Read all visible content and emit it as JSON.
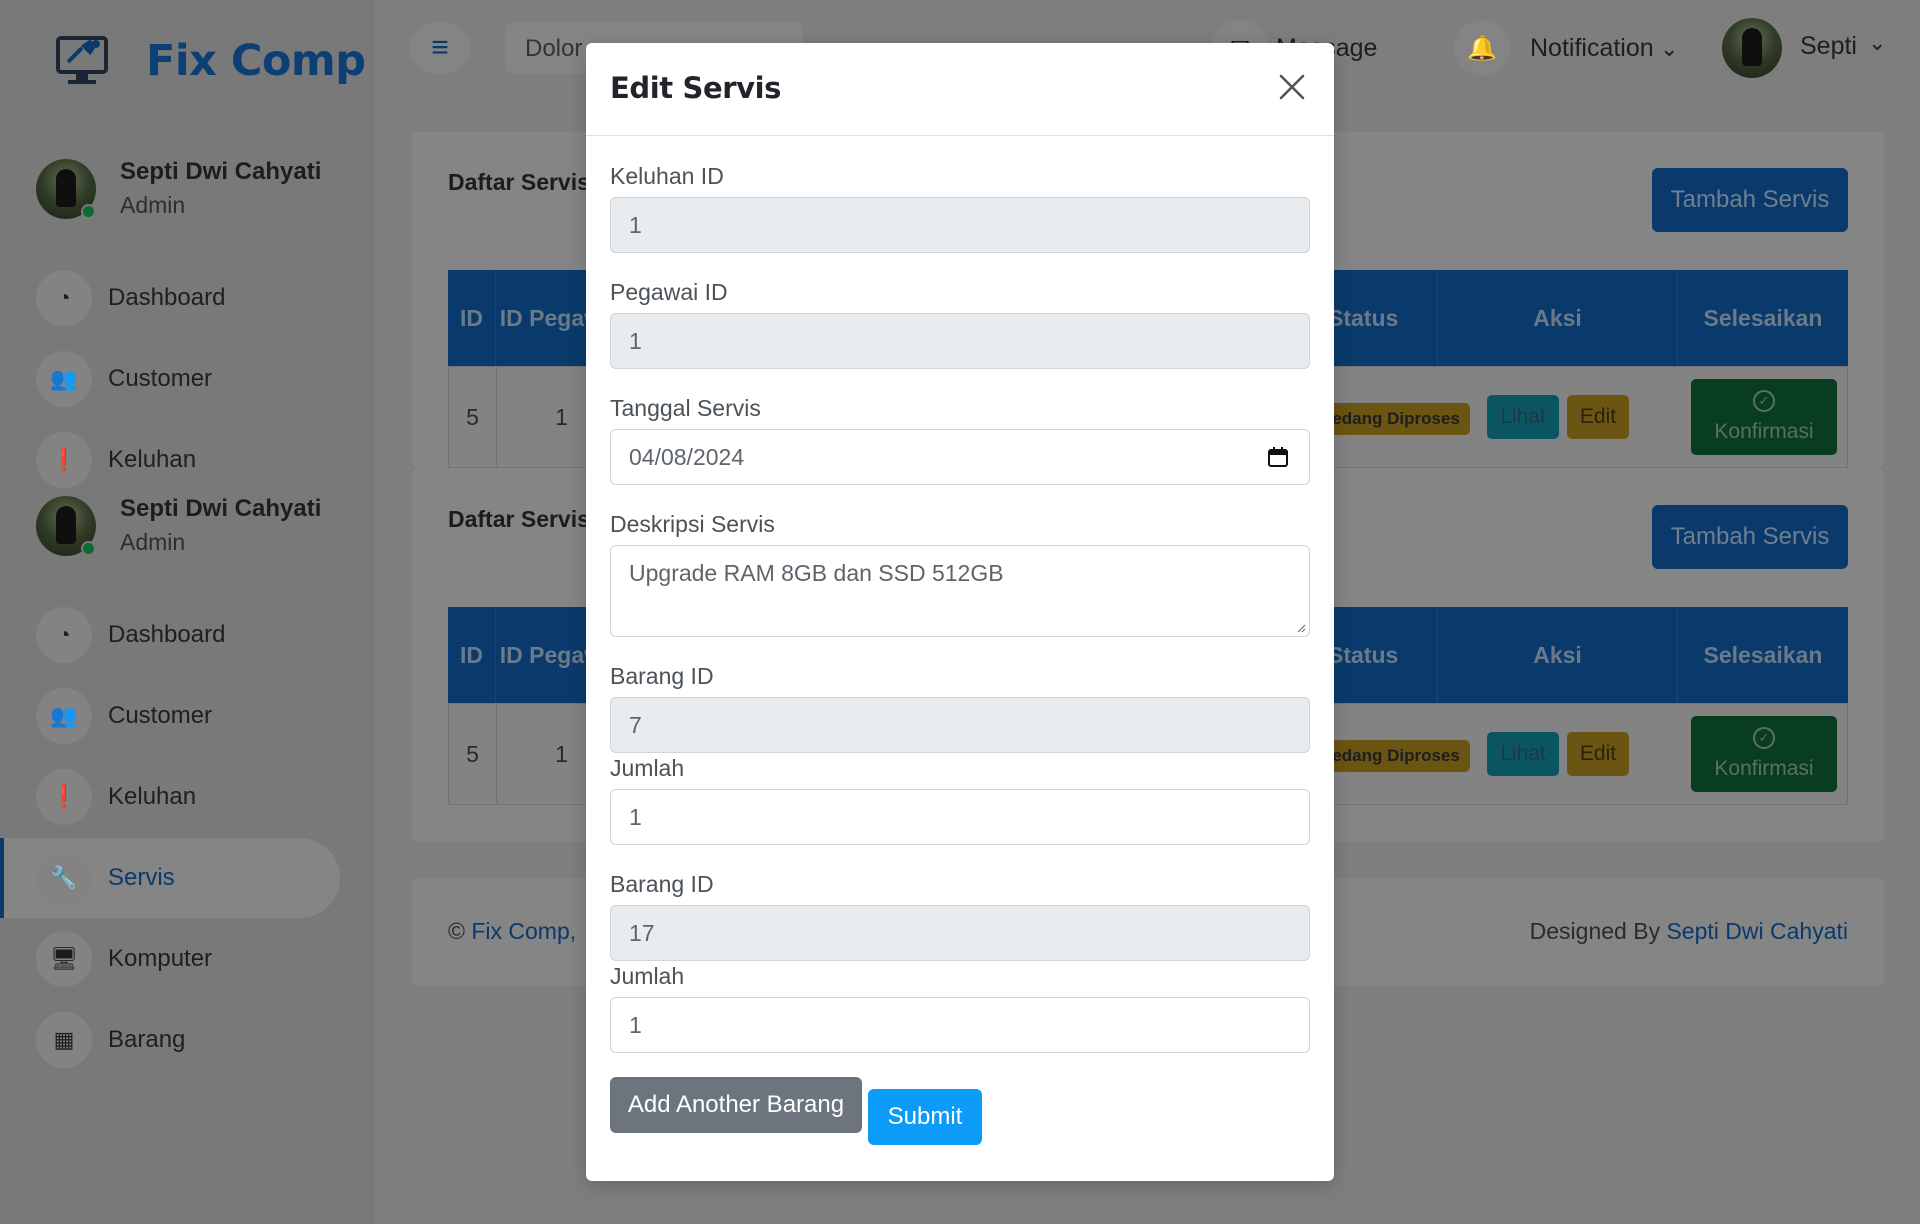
{
  "brand": {
    "name": "Fix Comp",
    "logo_icon": "computer-repair-icon"
  },
  "sidebar": {
    "profiles": [
      {
        "name": "Septi Dwi Cahyati",
        "role": "Admin"
      },
      {
        "name": "Septi Dwi Cahyati",
        "role": "Admin"
      }
    ],
    "nav_group1": [
      {
        "label": "Dashboard",
        "icon": "dashboard-icon"
      },
      {
        "label": "Customer",
        "icon": "users-icon"
      },
      {
        "label": "Keluhan",
        "icon": "exclamation-icon"
      }
    ],
    "nav_group2": [
      {
        "label": "Dashboard",
        "icon": "dashboard-icon"
      },
      {
        "label": "Customer",
        "icon": "users-icon"
      },
      {
        "label": "Keluhan",
        "icon": "exclamation-icon"
      },
      {
        "label": "Servis",
        "icon": "wrench-icon",
        "active": true
      },
      {
        "label": "Komputer",
        "icon": "monitor-icon"
      },
      {
        "label": "Barang",
        "icon": "boxes-icon"
      }
    ]
  },
  "topbar": {
    "search_placeholder": "Dolor",
    "message_label": "Message",
    "notification_label": "Notification",
    "user_label": "Septi"
  },
  "sections": [
    {
      "title": "Daftar Servis",
      "add_button": "Tambah Servis",
      "headers": {
        "id": "ID",
        "id_pegawai": "ID Pegawai",
        "status": "Status",
        "aksi": "Aksi",
        "selesaikan": "Selesaikan"
      },
      "row": {
        "id": "5",
        "id_pegawai": "1",
        "status": "Sedang Diproses",
        "lihat": "Lihat",
        "edit": "Edit",
        "konfirmasi": "Konfirmasi"
      }
    },
    {
      "title": "Daftar Servis",
      "add_button": "Tambah Servis",
      "headers": {
        "id": "ID",
        "id_pegawai": "ID Pegawai",
        "status": "Status",
        "aksi": "Aksi",
        "selesaikan": "Selesaikan"
      },
      "row": {
        "id": "5",
        "id_pegawai": "1",
        "status": "Sedang Diproses",
        "lihat": "Lihat",
        "edit": "Edit",
        "konfirmasi": "Konfirmasi"
      }
    }
  ],
  "footer": {
    "copyright_symbol": "©",
    "brand_link": "Fix Comp,",
    "designed_by": "Designed By",
    "designer_link": "Septi Dwi Cahyati"
  },
  "modal": {
    "title": "Edit Servis",
    "fields": {
      "keluhan_id": {
        "label": "Keluhan ID",
        "value": "1"
      },
      "pegawai_id": {
        "label": "Pegawai ID",
        "value": "1"
      },
      "tanggal_servis": {
        "label": "Tanggal Servis",
        "value": "04/08/2024"
      },
      "deskripsi_servis": {
        "label": "Deskripsi Servis",
        "value": "Upgrade RAM 8GB dan SSD 512GB"
      },
      "barang_1": {
        "label": "Barang ID",
        "value": "7"
      },
      "jumlah_1": {
        "label": "Jumlah",
        "value": "1"
      },
      "barang_2": {
        "label": "Barang ID",
        "value": "17"
      },
      "jumlah_2": {
        "label": "Jumlah",
        "value": "1"
      }
    },
    "add_button": "Add Another Barang",
    "submit_button": "Submit"
  },
  "colors": {
    "primary": "#0d6efd",
    "submit": "#0d9bf8",
    "secondary": "#6c757d",
    "overlay": "#7e7e7e"
  }
}
